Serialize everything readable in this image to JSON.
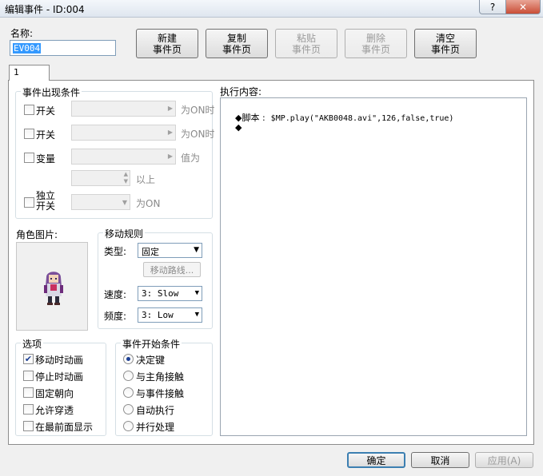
{
  "window": {
    "title": "编辑事件 - ID:004",
    "help_label": "?",
    "close_label": "✕"
  },
  "name": {
    "label": "名称:",
    "value": "EV004"
  },
  "toolbar": {
    "new": [
      "新建",
      "事件页"
    ],
    "copy": [
      "复制",
      "事件页"
    ],
    "paste": [
      "粘贴",
      "事件页"
    ],
    "delete": [
      "删除",
      "事件页"
    ],
    "clear": [
      "清空",
      "事件页"
    ]
  },
  "tabs": [
    {
      "label": "1"
    }
  ],
  "conditions": {
    "title": "事件出现条件",
    "switch1": {
      "label": "开关",
      "suffix": "为ON时"
    },
    "switch2": {
      "label": "开关",
      "suffix": "为ON时"
    },
    "variable": {
      "label": "变量",
      "suffix": "值为",
      "suffix2": "以上"
    },
    "self_switch": {
      "label_line1": "独立",
      "label_line2": "开关",
      "suffix": "为ON"
    }
  },
  "graphic": {
    "label": "角色图片:"
  },
  "movement": {
    "title": "移动规则",
    "type_label": "类型:",
    "type_value": "固定",
    "route_button": "移动路线...",
    "speed_label": "速度:",
    "speed_value": "3: Slow",
    "freq_label": "频度:",
    "freq_value": "3: Low"
  },
  "options": {
    "title": "选项",
    "items": [
      {
        "label": "移动时动画",
        "checked": true
      },
      {
        "label": "停止时动画",
        "checked": false
      },
      {
        "label": "固定朝向",
        "checked": false
      },
      {
        "label": "允许穿透",
        "checked": false
      },
      {
        "label": "在最前面显示",
        "checked": false
      }
    ]
  },
  "trigger": {
    "title": "事件开始条件",
    "items": [
      {
        "label": "决定键",
        "selected": true
      },
      {
        "label": "与主角接触",
        "selected": false
      },
      {
        "label": "与事件接触",
        "selected": false
      },
      {
        "label": "自动执行",
        "selected": false
      },
      {
        "label": "并行处理",
        "selected": false
      }
    ]
  },
  "exec": {
    "label": "执行内容:",
    "lines": [
      {
        "marker": "◆",
        "keyword": "脚本 :",
        "code": "$MP.play(\"AKB0048.avi\",126,false,true)"
      },
      {
        "marker": "◆",
        "keyword": "",
        "code": ""
      }
    ]
  },
  "footer": {
    "ok": "确定",
    "cancel": "取消",
    "apply": "应用(A)"
  },
  "colors": {
    "selection": "#3399ff",
    "check": "#1c3f93"
  },
  "icons": {
    "check": "✔",
    "arrow_right": "▶",
    "arrow_down": "▼"
  }
}
